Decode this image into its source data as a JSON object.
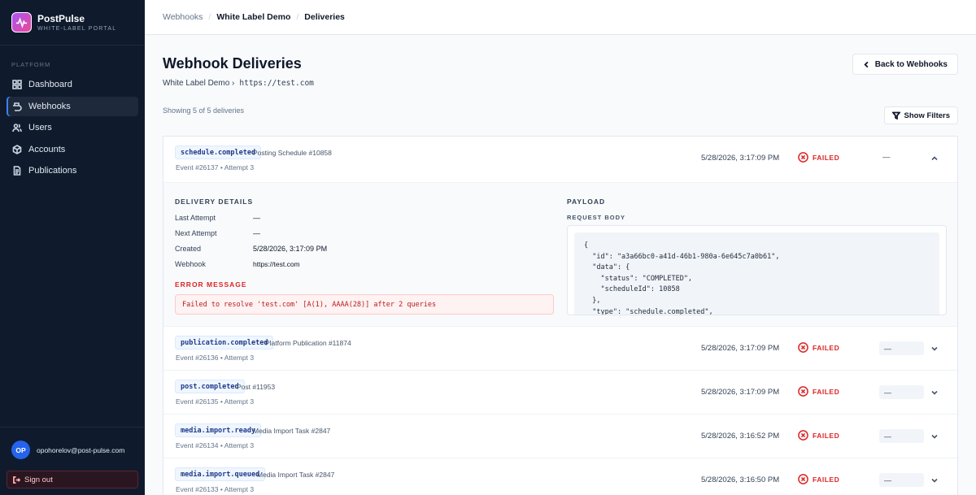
{
  "brand": {
    "name": "PostPulse",
    "subtitle": "WHITE-LABEL PORTAL",
    "logo_icon": "pulse-logo-icon"
  },
  "sidebar": {
    "section": "PLATFORM",
    "items": [
      {
        "label": "Dashboard",
        "icon": "grid-icon",
        "active": false
      },
      {
        "label": "Webhooks",
        "icon": "webhook-icon",
        "active": true
      },
      {
        "label": "Users",
        "icon": "users-icon",
        "active": false
      },
      {
        "label": "Accounts",
        "icon": "cube-icon",
        "active": false
      },
      {
        "label": "Publications",
        "icon": "document-icon",
        "active": false
      }
    ],
    "user": {
      "initials": "OP",
      "email": "opohorelov@post-pulse.com"
    },
    "signout_label": "Sign out"
  },
  "breadcrumb": [
    "Webhooks",
    "White Label Demo",
    "Deliveries"
  ],
  "page": {
    "title": "Webhook Deliveries",
    "webhook_name": "White Label Demo ›",
    "webhook_url": "https://test.com",
    "back_label": "Back to Webhooks",
    "showing": "Showing 5 of 5 deliveries",
    "filters_label": "Show Filters"
  },
  "deliveries": [
    {
      "event": "schedule.completed",
      "source": "Posting Schedule #10858",
      "meta": "Event #26137 • Attempt 3",
      "timestamp": "5/28/2026, 3:17:09 PM",
      "status": "FAILED",
      "response": "—",
      "expanded": true
    },
    {
      "event": "publication.completed",
      "source": "Platform Publication #11874",
      "meta": "Event #26136 • Attempt 3",
      "timestamp": "5/28/2026, 3:17:09 PM",
      "status": "FAILED",
      "response": "—",
      "expanded": false
    },
    {
      "event": "post.completed",
      "source": "Post #11953",
      "meta": "Event #26135 • Attempt 3",
      "timestamp": "5/28/2026, 3:17:09 PM",
      "status": "FAILED",
      "response": "—",
      "expanded": false
    },
    {
      "event": "media.import.ready",
      "source": "Media Import Task #2847",
      "meta": "Event #26134 • Attempt 3",
      "timestamp": "5/28/2026, 3:16:52 PM",
      "status": "FAILED",
      "response": "—",
      "expanded": false
    },
    {
      "event": "media.import.queued",
      "source": "Media Import Task #2847",
      "meta": "Event #26133 • Attempt 3",
      "timestamp": "5/28/2026, 3:16:50 PM",
      "status": "FAILED",
      "response": "—",
      "expanded": false
    }
  ],
  "details": {
    "title": "DELIVERY DETAILS",
    "fields": [
      {
        "label": "Last Attempt",
        "value": "—"
      },
      {
        "label": "Next Attempt",
        "value": "—"
      },
      {
        "label": "Created",
        "value": "5/28/2026, 3:17:09 PM"
      },
      {
        "label": "Webhook",
        "value": "https://test.com"
      }
    ],
    "error_title": "ERROR MESSAGE",
    "error_message": "Failed to resolve 'test.com' [A(1), AAAA(28)] after 2 queries",
    "payload_title": "PAYLOAD",
    "request_body_label": "REQUEST BODY",
    "request_body": "{\n  \"id\": \"a3a66bc0-a41d-46b1-980a-6e645c7a0b61\",\n  \"data\": {\n    \"status\": \"COMPLETED\",\n    \"scheduleId\": 10858\n  },\n  \"type\": \"schedule.completed\","
  },
  "colors": {
    "sidebar": "#0f1b2d",
    "accent": "#2563eb",
    "failed": "#dc2626"
  }
}
